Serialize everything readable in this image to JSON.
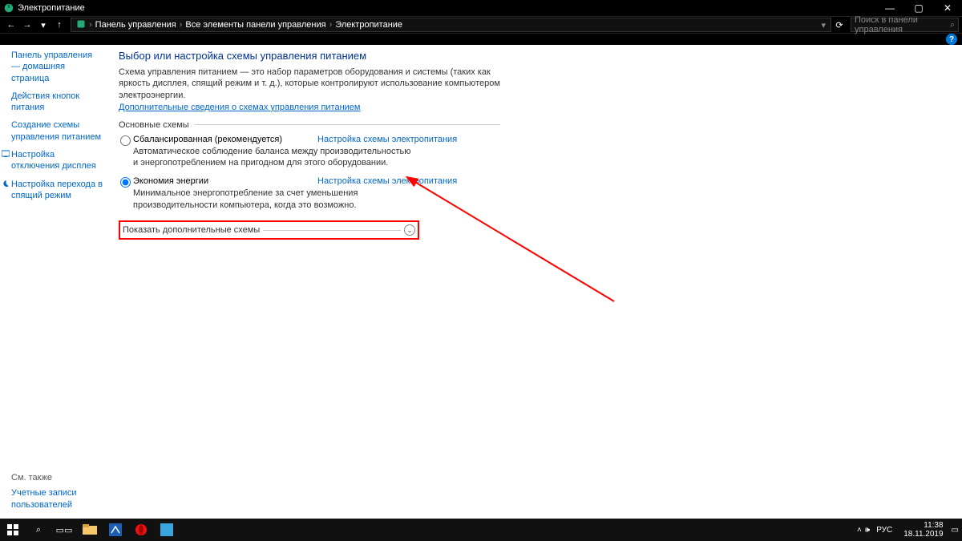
{
  "window": {
    "title": "Электропитание",
    "controls": {
      "min": "—",
      "max": "▢",
      "close": "✕"
    }
  },
  "nav": {
    "back": "←",
    "forward": "→",
    "down": "▾",
    "up": "↑",
    "refresh": "⟳",
    "breadcrumb": {
      "root": "Панель управления",
      "mid": "Все элементы панели управления",
      "leaf": "Электропитание",
      "sep": "›"
    },
    "refresh_hint": "↻",
    "search_placeholder": "Поиск в панели управления",
    "help": "?"
  },
  "sidebar": {
    "items": [
      {
        "label": "Панель управления — домашняя страница"
      },
      {
        "label": "Действия кнопок питания"
      },
      {
        "label": "Создание схемы управления питанием"
      },
      {
        "label": "Настройка отключения дисплея",
        "icon": "display"
      },
      {
        "label": "Настройка перехода в спящий режим",
        "icon": "moon"
      }
    ],
    "see_also": "См. также",
    "accounts": "Учетные записи пользователей"
  },
  "main": {
    "title": "Выбор или настройка схемы управления питанием",
    "desc": "Схема управления питанием — это набор параметров оборудования и системы (таких как яркость дисплея, спящий режим и т. д.), которые контролируют использование компьютером электроэнергии.",
    "info_link": "Дополнительные сведения о схемах управления питанием",
    "plans_header": "Основные схемы",
    "plans": [
      {
        "name": "Сбалансированная (рекомендуется)",
        "link": "Настройка схемы электропитания",
        "desc": "Автоматическое соблюдение баланса между производительностью и энергопотреблением на пригодном для этого оборудовании.",
        "selected": false
      },
      {
        "name": "Экономия энергии",
        "link": "Настройка схемы электропитания",
        "desc": "Минимальное энергопотребление за счет уменьшения производительности компьютера, когда это возможно.",
        "selected": true
      }
    ],
    "expand_label": "Показать дополнительные схемы"
  },
  "taskbar": {
    "lang": "РУС",
    "time": "11:38",
    "date": "18.11.2019"
  }
}
